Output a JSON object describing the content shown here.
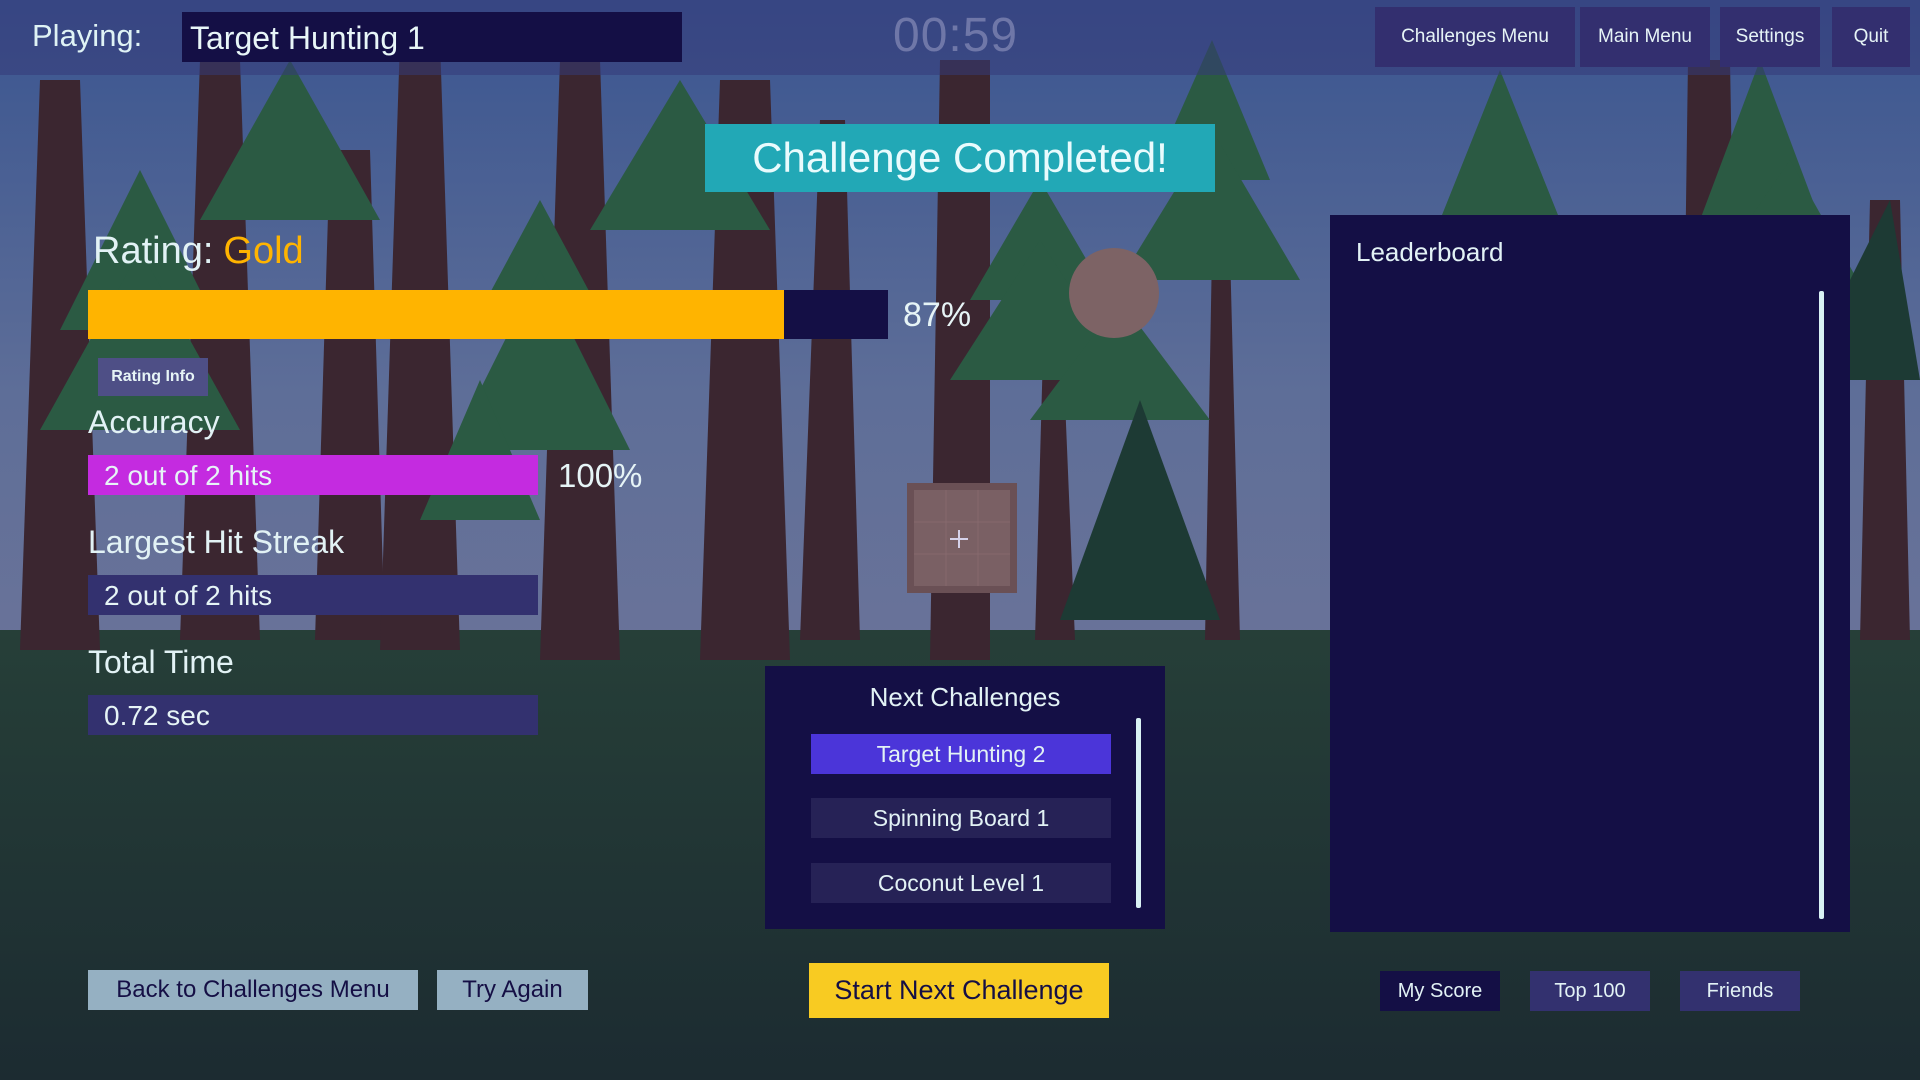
{
  "header": {
    "playing_label": "Playing:",
    "challenge_name": "Target Hunting 1",
    "timer": "00:59",
    "nav_buttons": [
      "Challenges Menu",
      "Main Menu",
      "Settings",
      "Quit"
    ]
  },
  "banner": "Challenge Completed!",
  "rating": {
    "label": "Rating:",
    "value": "Gold",
    "progress_percent": 87,
    "progress_text": "87%",
    "info_button": "Rating Info",
    "color": "#ffb400"
  },
  "stats": {
    "accuracy": {
      "label": "Accuracy",
      "value": "2 out of 2 hits",
      "percent": "100%",
      "color": "#c42be0"
    },
    "streak": {
      "label": "Largest Hit Streak",
      "value": "2 out of 2 hits"
    },
    "time": {
      "label": "Total Time",
      "value": "0.72 sec"
    }
  },
  "next_challenges": {
    "title": "Next Challenges",
    "items": [
      "Target Hunting 2",
      "Spinning Board 1",
      "Coconut Level 1"
    ],
    "selected_index": 0
  },
  "leaderboard": {
    "title": "Leaderboard",
    "tabs": [
      "My Score",
      "Top 100",
      "Friends"
    ],
    "active_tab": 0
  },
  "footer": {
    "back_button": "Back to Challenges Menu",
    "retry_button": "Try Again",
    "start_next_button": "Start Next Challenge"
  }
}
